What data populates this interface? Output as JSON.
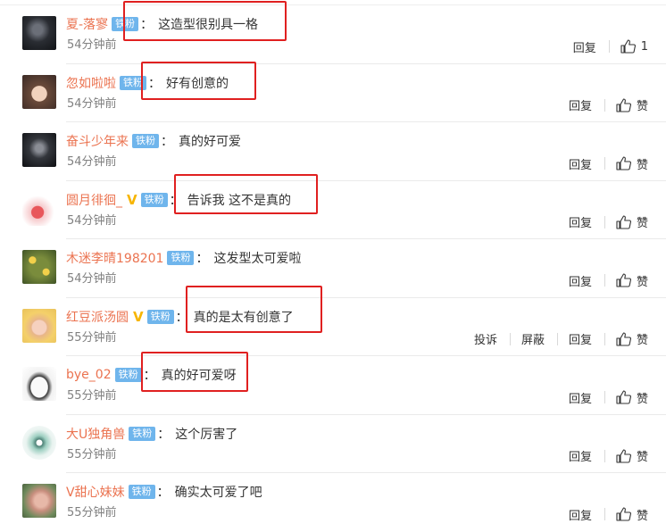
{
  "actions": {
    "report": "投诉",
    "block": "屏蔽",
    "reply": "回复",
    "like": "赞"
  },
  "badge_label": "铁粉",
  "colors": {
    "username": "#eb7350",
    "badge_bg": "#6fb5ec",
    "highlight_box": "#e02020",
    "vip_badge": "#f7b500"
  },
  "comments": [
    {
      "user": "夏-落寥",
      "vip": false,
      "text": "这造型很别具一格",
      "time": "54分钟前",
      "like_label": "1",
      "show_report": false,
      "highlighted": true,
      "avatar": "dark-figure"
    },
    {
      "user": "忽如啦啦",
      "vip": false,
      "text": "好有创意的",
      "time": "54分钟前",
      "like_label": "赞",
      "show_report": false,
      "highlighted": true,
      "avatar": "girl-portrait"
    },
    {
      "user": "奋斗少年来",
      "vip": false,
      "text": "真的好可爱",
      "time": "54分钟前",
      "like_label": "赞",
      "show_report": false,
      "highlighted": false,
      "avatar": "dark-warrior"
    },
    {
      "user": "圆月徘徊_",
      "vip": true,
      "text": "告诉我 这不是真的",
      "time": "54分钟前",
      "like_label": "赞",
      "show_report": false,
      "highlighted": true,
      "avatar": "cartoon-bunny"
    },
    {
      "user": "木迷李晴198201",
      "vip": false,
      "text": "这发型太可爱啦",
      "time": "54分钟前",
      "like_label": "赞",
      "show_report": false,
      "highlighted": false,
      "avatar": "yellow-flowers"
    },
    {
      "user": "红豆派汤圆",
      "vip": true,
      "text": "真的是太有创意了",
      "time": "55分钟前",
      "like_label": "赞",
      "show_report": true,
      "highlighted": true,
      "avatar": "blonde-girl"
    },
    {
      "user": "bye_02",
      "vip": false,
      "text": "真的好可爱呀",
      "time": "55分钟前",
      "like_label": "赞",
      "show_report": false,
      "highlighted": true,
      "avatar": "white-bird"
    },
    {
      "user": "大U独角兽",
      "vip": false,
      "text": "这个厉害了",
      "time": "55分钟前",
      "like_label": "赞",
      "show_report": false,
      "highlighted": false,
      "avatar": "owl-cartoon"
    },
    {
      "user": "V甜心妹妹",
      "vip": false,
      "text": "确实太可爱了吧",
      "time": "55分钟前",
      "like_label": "赞",
      "show_report": false,
      "highlighted": false,
      "avatar": "pig-photo"
    }
  ]
}
